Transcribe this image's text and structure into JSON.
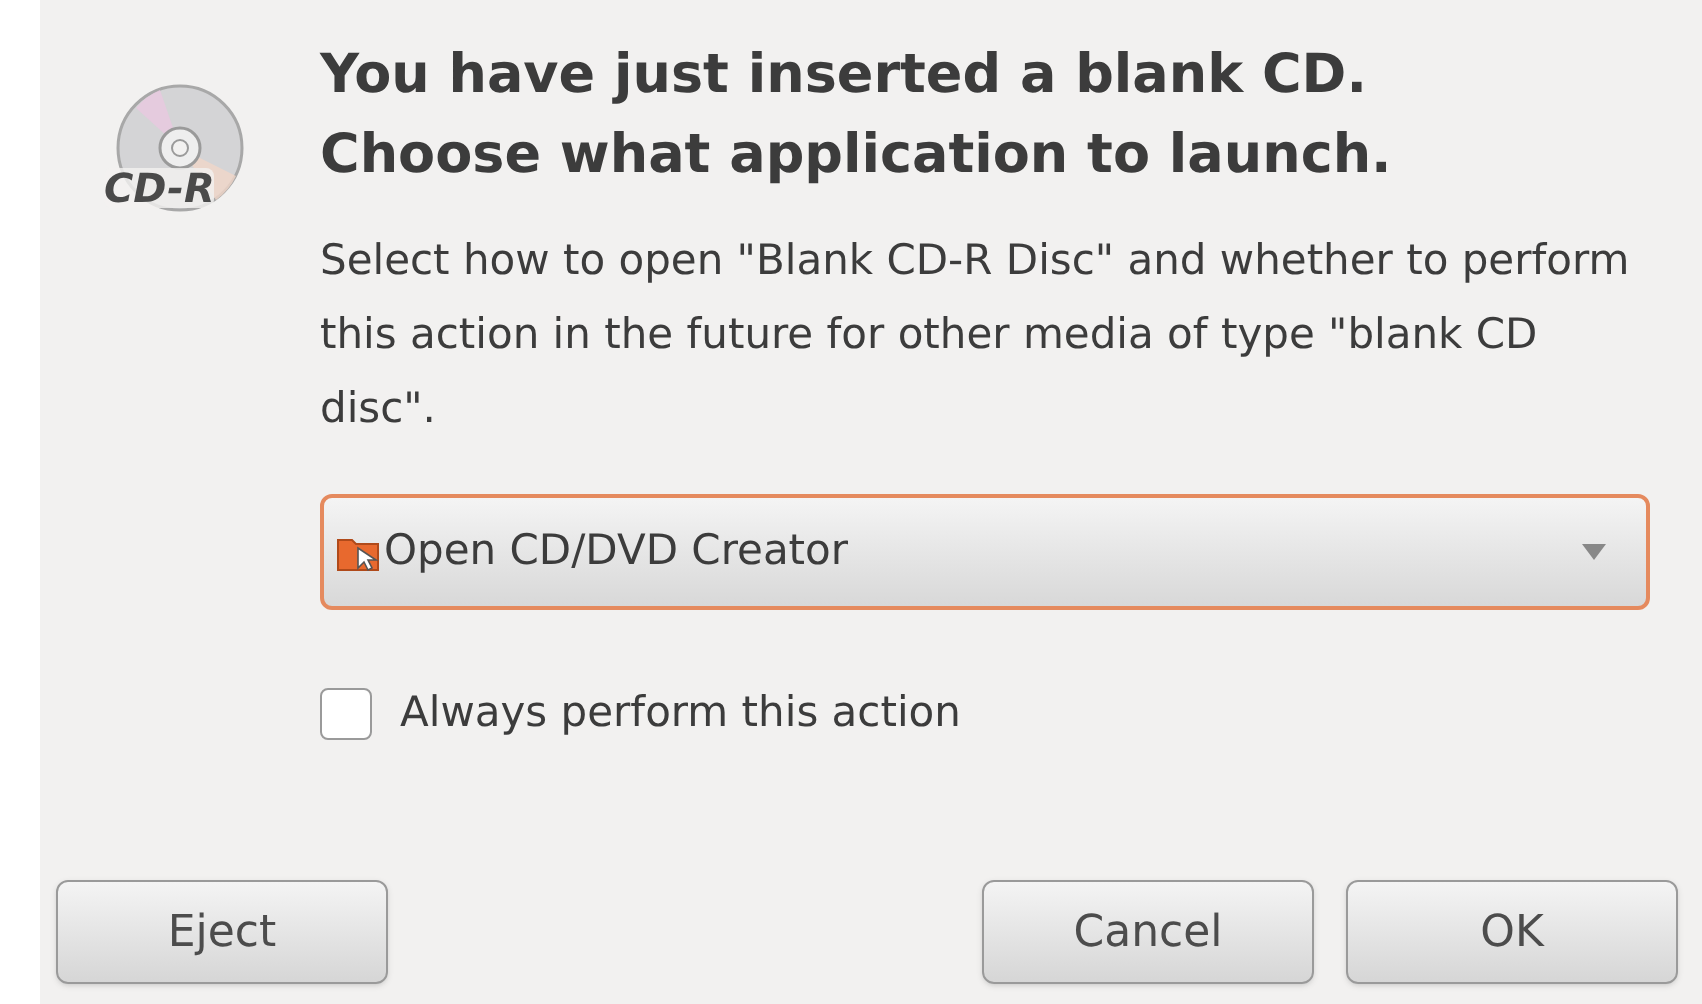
{
  "icon_label": "CD-R",
  "title": "You have just inserted a blank CD.\nChoose what application to launch.",
  "message": "Select how to open \"Blank CD-R Disc\" and whether to perform this action in the future for other media of type \"blank CD disc\".",
  "dropdown": {
    "value": "Open CD/DVD Creator"
  },
  "checkbox": {
    "label": "Always perform this action",
    "checked": false
  },
  "buttons": [
    {
      "label": "Eject",
      "kind": "left"
    },
    {
      "label": "Cancel",
      "kind": "right"
    },
    {
      "label": "OK",
      "kind": "right"
    }
  ]
}
